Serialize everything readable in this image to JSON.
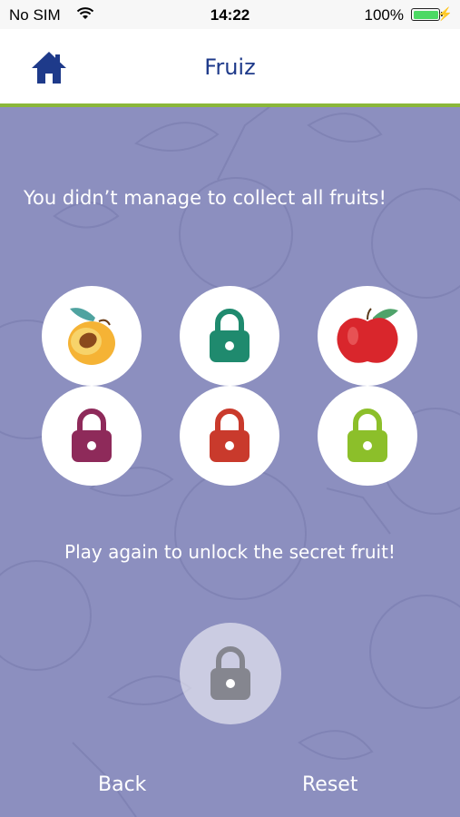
{
  "status_bar": {
    "carrier": "No SIM",
    "time": "14:22",
    "battery_percent": "100%"
  },
  "nav": {
    "title": "Fruiz",
    "home_icon": "home-icon",
    "accent_color": "#8ab73a",
    "title_color": "#1e3a8a"
  },
  "game": {
    "result_message": "You didn’t manage to collect all fruits!",
    "unlock_message": "Play again to unlock the secret fruit!",
    "fruits": [
      {
        "state": "collected",
        "fruit": "apricot"
      },
      {
        "state": "locked",
        "color": "#1f8a6e"
      },
      {
        "state": "collected",
        "fruit": "apple"
      },
      {
        "state": "locked",
        "color": "#8e2a5a"
      },
      {
        "state": "locked",
        "color": "#c93a2c"
      },
      {
        "state": "locked",
        "color": "#8cbf2a"
      }
    ],
    "secret_fruit": {
      "state": "locked",
      "color": "#85868f"
    }
  },
  "footer": {
    "back_label": "Back",
    "reset_label": "Reset"
  },
  "colors": {
    "background": "#8c8fbf"
  }
}
